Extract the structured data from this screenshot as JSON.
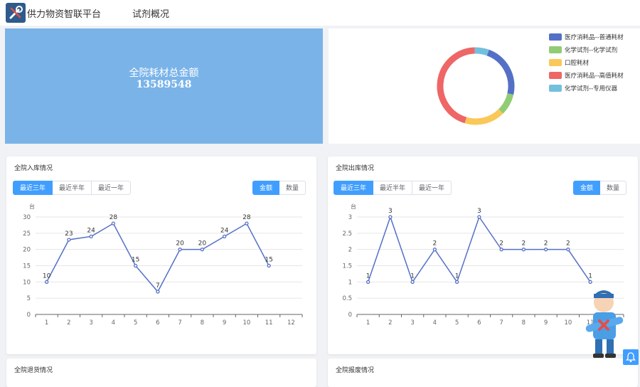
{
  "header": {
    "app_title": "供力物资智联平台",
    "nav_item": "试剂概况"
  },
  "summary": {
    "label": "全院耗材总金额",
    "value": "13589548"
  },
  "donut": {
    "legend": [
      {
        "label": "医疗消耗品--普通耗材",
        "color": "#5470c6"
      },
      {
        "label": "化学试剂--化学试剂",
        "color": "#91cc75"
      },
      {
        "label": "口腔耗材",
        "color": "#fac858"
      },
      {
        "label": "医疗消耗品--高值耗材",
        "color": "#ee6666"
      },
      {
        "label": "化学试剂--专用仪器",
        "color": "#73c0de"
      }
    ],
    "share": [
      0.23,
      0.09,
      0.17,
      0.45,
      0.06
    ]
  },
  "panels": {
    "inbound": {
      "title": "全院入库情况"
    },
    "outbound": {
      "title": "全院出库情况"
    },
    "returns": {
      "title": "全院退货情况"
    },
    "scrap": {
      "title": "全院报废情况"
    }
  },
  "controls": {
    "period": [
      "最近三年",
      "最近半年",
      "最近一年"
    ],
    "metric": [
      "金额",
      "数量"
    ]
  },
  "chart_data": [
    {
      "type": "line",
      "ylabel": "台",
      "x": [
        1,
        2,
        3,
        4,
        5,
        6,
        7,
        8,
        9,
        10,
        11,
        12
      ],
      "ylim": [
        0,
        30
      ],
      "yticks": [
        0,
        5,
        10,
        15,
        20,
        25,
        30
      ],
      "series": [
        {
          "values": [
            10,
            23,
            24,
            28,
            15,
            7,
            20,
            20,
            24,
            28,
            15,
            null
          ]
        }
      ]
    },
    {
      "type": "line",
      "ylabel": "台",
      "x": [
        1,
        2,
        3,
        4,
        5,
        6,
        7,
        8,
        9,
        10,
        11,
        12
      ],
      "ylim": [
        0,
        3
      ],
      "yticks": [
        0,
        0.5,
        1,
        1.5,
        2,
        2.5,
        3
      ],
      "series": [
        {
          "values": [
            1,
            3,
            1,
            2,
            1,
            3,
            2,
            2,
            2,
            2,
            1,
            null
          ]
        }
      ]
    }
  ]
}
